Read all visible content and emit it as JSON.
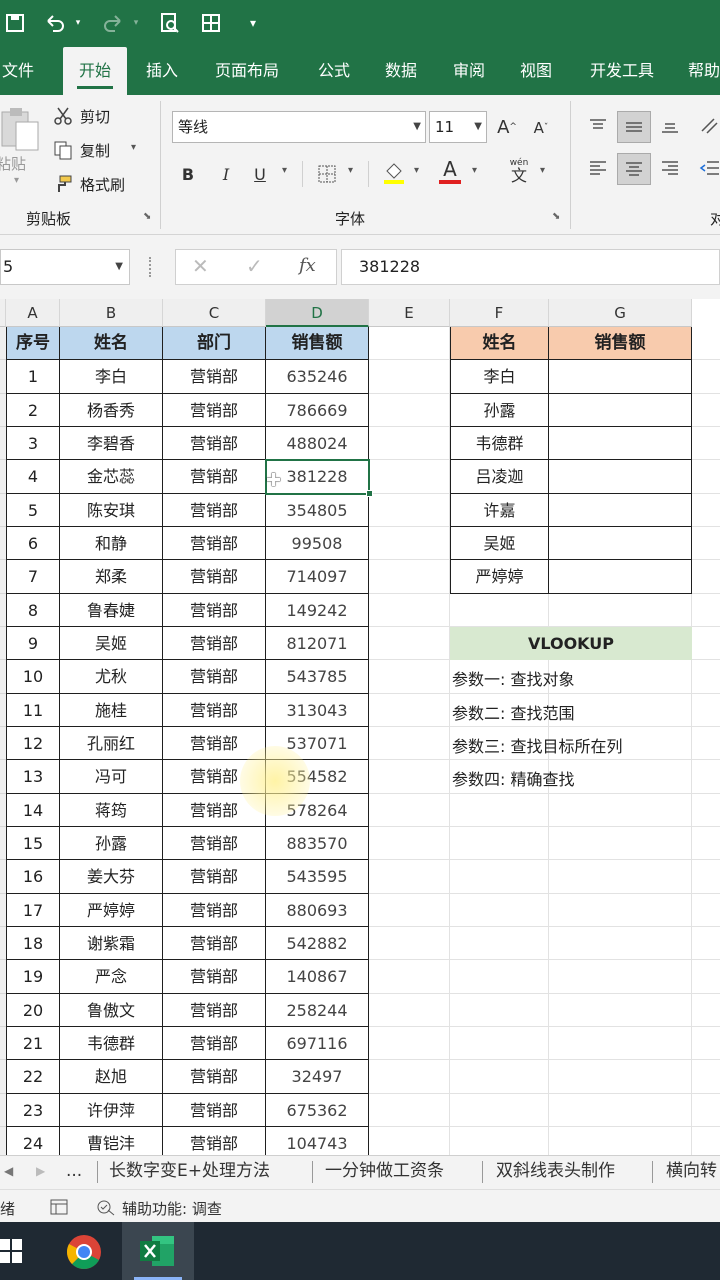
{
  "tabs": [
    "文件",
    "开始",
    "插入",
    "页面布局",
    "公式",
    "数据",
    "审阅",
    "视图",
    "开发工具",
    "帮助"
  ],
  "ribbon": {
    "paste_label": "粘贴",
    "cut": "剪切",
    "copy": "复制",
    "format_painter": "格式刷",
    "clipboard_group": "剪贴板",
    "font_name": "等线",
    "font_size": "11",
    "font_group": "字体",
    "bold": "B",
    "italic": "I",
    "underline": "U",
    "grow": "A",
    "shrink": "A",
    "font_color_glyph": "A",
    "wen": "wén",
    "wen_char": "文",
    "align_group_partial": "对"
  },
  "formula_bar": {
    "name_box": "5",
    "fx": "fx",
    "value": "381228"
  },
  "columns": [
    "A",
    "B",
    "C",
    "D",
    "E",
    "F",
    "G"
  ],
  "main_table": {
    "headers": [
      "序号",
      "姓名",
      "部门",
      "销售额"
    ],
    "rows": [
      [
        "1",
        "李白",
        "营销部",
        "635246"
      ],
      [
        "2",
        "杨香秀",
        "营销部",
        "786669"
      ],
      [
        "3",
        "李碧香",
        "营销部",
        "488024"
      ],
      [
        "4",
        "金芯蕊",
        "营销部",
        "381228"
      ],
      [
        "5",
        "陈安琪",
        "营销部",
        "354805"
      ],
      [
        "6",
        "和静",
        "营销部",
        "99508"
      ],
      [
        "7",
        "郑柔",
        "营销部",
        "714097"
      ],
      [
        "8",
        "鲁春婕",
        "营销部",
        "149242"
      ],
      [
        "9",
        "吴姬",
        "营销部",
        "812071"
      ],
      [
        "10",
        "尤秋",
        "营销部",
        "543785"
      ],
      [
        "11",
        "施桂",
        "营销部",
        "313043"
      ],
      [
        "12",
        "孔丽红",
        "营销部",
        "537071"
      ],
      [
        "13",
        "冯可",
        "营销部",
        "554582"
      ],
      [
        "14",
        "蒋筠",
        "营销部",
        "578264"
      ],
      [
        "15",
        "孙露",
        "营销部",
        "883570"
      ],
      [
        "16",
        "姜大芬",
        "营销部",
        "543595"
      ],
      [
        "17",
        "严婷婷",
        "营销部",
        "880693"
      ],
      [
        "18",
        "谢紫霜",
        "营销部",
        "542882"
      ],
      [
        "19",
        "严念",
        "营销部",
        "140867"
      ],
      [
        "20",
        "鲁傲文",
        "营销部",
        "258244"
      ],
      [
        "21",
        "韦德群",
        "营销部",
        "697116"
      ],
      [
        "22",
        "赵旭",
        "营销部",
        "32497"
      ],
      [
        "23",
        "许伊萍",
        "营销部",
        "675362"
      ],
      [
        "24",
        "曹铠沣",
        "营销部",
        "104743"
      ]
    ]
  },
  "lookup_table": {
    "headers": [
      "姓名",
      "销售额"
    ],
    "names": [
      "李白",
      "孙露",
      "韦德群",
      "吕凌迦",
      "许嘉",
      "吴姬",
      "严婷婷"
    ]
  },
  "vlookup": {
    "title": "VLOOKUP",
    "params": [
      "参数一:  查找对象",
      "参数二:  查找范围",
      "参数三:  查找目标所在列",
      "参数四:  精确查找"
    ]
  },
  "sheet_tabs": {
    "ellipsis": "...",
    "items": [
      "长数字变E+处理方法",
      "一分钟做工资条",
      "双斜线表头制作",
      "横向转"
    ]
  },
  "status": {
    "ready": "绪",
    "accessibility": "辅助功能: 调查"
  },
  "colors": {
    "excel_green": "#217346",
    "header_blue": "#bdd7ee",
    "header_orange": "#f8cbad",
    "vlookup_green": "#d8e9d0"
  }
}
